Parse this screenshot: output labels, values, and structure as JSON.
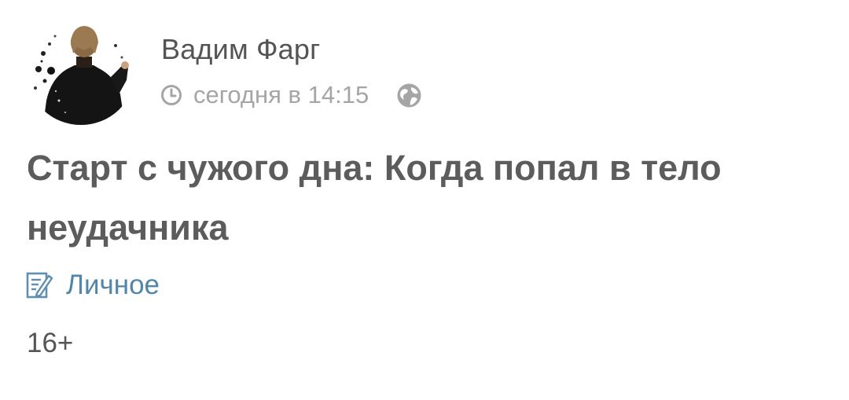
{
  "author": {
    "name": "Вадим Фарг",
    "avatar_icon": "avatar-image"
  },
  "meta": {
    "timestamp": "сегодня в 14:15",
    "clock_icon": "clock-icon",
    "visibility_icon": "globe-icon"
  },
  "post": {
    "title": "Старт с чужого дна: Когда попал в тело неудачника"
  },
  "category": {
    "icon": "notes-icon",
    "label": "Личное"
  },
  "age_rating": "16+",
  "colors": {
    "title": "#5c5c5c",
    "author": "#545454",
    "meta": "#a5a5a5",
    "category_link": "#5286a8",
    "icon_gray": "#9a9a9a",
    "category_icon": "#5f8fb0"
  }
}
